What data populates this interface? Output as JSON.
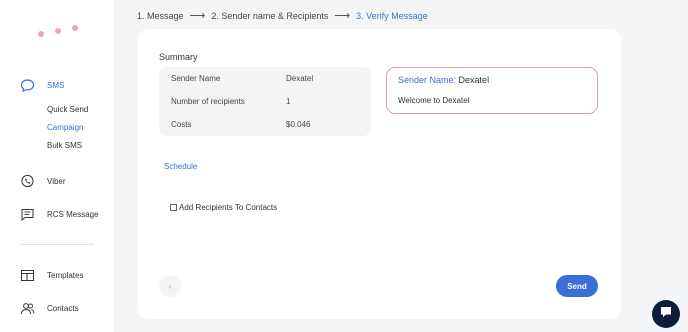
{
  "sidebar": {
    "logo_dots_color": "#e9a8b4",
    "items": [
      {
        "label": "SMS",
        "icon": "chat-bubble-icon",
        "active": true
      },
      {
        "label": "Viber",
        "icon": "phone-bubble-icon"
      },
      {
        "label": "RCS Message",
        "icon": "message-lines-icon"
      },
      {
        "label": "Templates",
        "icon": "layout-icon"
      },
      {
        "label": "Contacts",
        "icon": "users-icon"
      }
    ],
    "sms_subitems": [
      {
        "label": "Quick Send"
      },
      {
        "label": "Campaign",
        "active": true
      },
      {
        "label": "Bulk SMS"
      }
    ]
  },
  "breadcrumb": {
    "step1": "1. Message",
    "step2": "2. Sender name & Recipients",
    "step3": "3. Verify Message"
  },
  "summary": {
    "title": "Summary",
    "rows": [
      {
        "label": "Sender Name",
        "value": "Dexatel"
      },
      {
        "label": "Number of recipients",
        "value": "1"
      },
      {
        "label": "Costs",
        "value": "$0.046"
      }
    ]
  },
  "preview": {
    "sender_label": "Sender Name:",
    "sender_value": "Dexatel",
    "message": "Welcome to Dexatel"
  },
  "schedule_label": "Schedule",
  "add_recipients_label": "Add Recipients To Contacts",
  "send_label": "Send",
  "colors": {
    "accent": "#3a6fd8",
    "preview_border": "#d9a4b0",
    "chat_fab": "#0c1d3b"
  }
}
